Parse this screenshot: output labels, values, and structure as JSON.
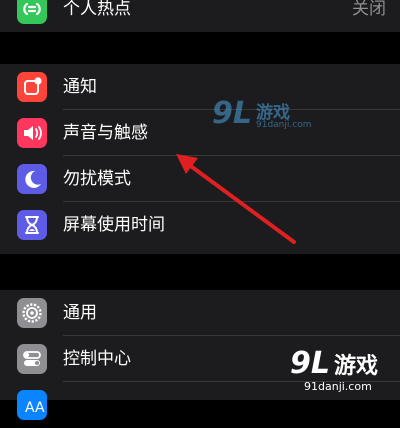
{
  "groups": [
    {
      "items": [
        {
          "label": "个人热点",
          "value": "关闭",
          "icon": "personal-hotspot-icon",
          "color": "#34c759"
        }
      ]
    },
    {
      "items": [
        {
          "label": "通知",
          "icon": "notifications-icon",
          "color": "#ff453a"
        },
        {
          "label": "声音与触感",
          "icon": "sounds-haptics-icon",
          "color": "#ff375f"
        },
        {
          "label": "勿扰模式",
          "icon": "do-not-disturb-moon-icon",
          "color": "#5e5ce6"
        },
        {
          "label": "屏幕使用时间",
          "icon": "screen-time-hourglass-icon",
          "color": "#5e5ce6"
        }
      ]
    },
    {
      "items": [
        {
          "label": "通用",
          "icon": "general-gear-icon",
          "color": "#8e8e93"
        },
        {
          "label": "控制中心",
          "icon": "control-center-icon",
          "color": "#8e8e93"
        },
        {
          "label": "",
          "icon": "display-brightness-icon",
          "color": "#0a84ff"
        }
      ]
    }
  ],
  "watermark_top": {
    "logo": "9L",
    "name": "游戏",
    "url": "91danji.com"
  },
  "watermark_bottom": {
    "logo": "9L",
    "name": "游戏",
    "url": "91danji.com"
  }
}
